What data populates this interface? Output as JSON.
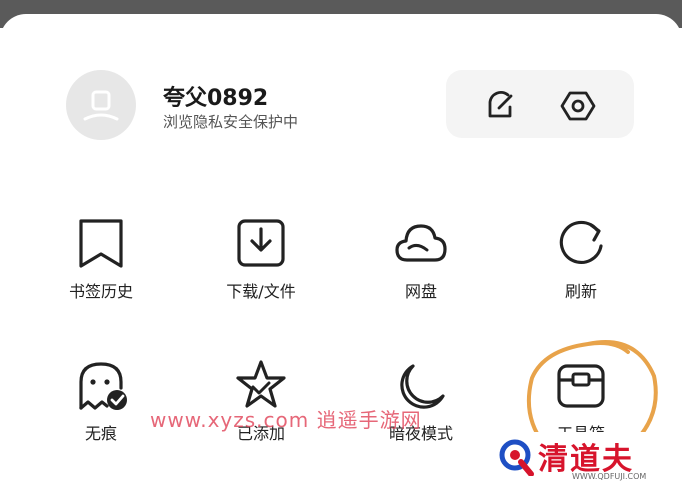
{
  "profile": {
    "username": "夸父0892",
    "status": "浏览隐私安全保护中"
  },
  "actions": {
    "edit_icon": "edit-icon",
    "settings_icon": "hexagon-settings-icon"
  },
  "grid": [
    {
      "label": "书签历史",
      "icon": "bookmark-icon"
    },
    {
      "label": "下载/文件",
      "icon": "download-icon"
    },
    {
      "label": "网盘",
      "icon": "cloud-icon"
    },
    {
      "label": "刷新",
      "icon": "refresh-icon"
    },
    {
      "label": "无痕",
      "icon": "ghost-icon"
    },
    {
      "label": "已添加",
      "icon": "star-icon"
    },
    {
      "label": "暗夜模式",
      "icon": "moon-icon"
    },
    {
      "label": "工具箱",
      "icon": "toolbox-icon"
    }
  ],
  "watermark": "www.xyzs.com 逍遥手游网",
  "brand": {
    "name": "清道夫",
    "url": "WWW.QDFUJI.COM"
  },
  "colors": {
    "watermark": "#e1465a",
    "brand": "#d7142c",
    "annotation_circle": "#e8a34a",
    "icon_stroke": "#222222"
  }
}
